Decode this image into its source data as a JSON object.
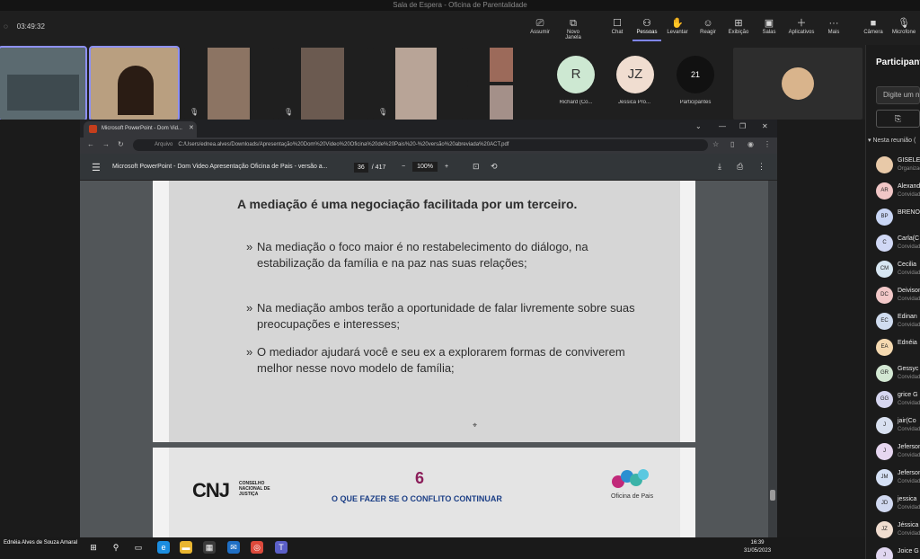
{
  "window_title": "Sala de Espera - Oficina de Parentalidade",
  "meeting": {
    "timer": "03:49:32"
  },
  "toolbar": [
    {
      "label": "Assumir",
      "icon": "screen-share-icon"
    },
    {
      "label": "Novo Janela",
      "icon": "new-window-icon"
    },
    {
      "label": "Chat",
      "icon": "chat-icon"
    },
    {
      "label": "Pessoas",
      "icon": "people-icon",
      "active": true
    },
    {
      "label": "Levantar",
      "icon": "raise-hand-icon"
    },
    {
      "label": "Reagir",
      "icon": "react-icon"
    },
    {
      "label": "Exibição",
      "icon": "view-icon"
    },
    {
      "label": "Salas",
      "icon": "rooms-icon"
    },
    {
      "label": "Aplicativos",
      "icon": "apps-icon"
    },
    {
      "label": "Mais",
      "icon": "more-icon"
    },
    {
      "label": "Câmera",
      "icon": "camera-icon"
    },
    {
      "label": "Microfone",
      "icon": "microphone-icon"
    }
  ],
  "avatars": [
    {
      "initial": "R",
      "name": "Richard (Co...",
      "color": "#cde8d2"
    },
    {
      "initial": "JZ",
      "name": "Jessica Pro...",
      "color": "#f0ddd0"
    },
    {
      "initial": "21",
      "name": "Participantes",
      "color": "#111111"
    }
  ],
  "right_panel": {
    "title": "Participantes",
    "search_placeholder": "Digite um nome",
    "share_label": "⎘",
    "section": "Nesta reunião (",
    "people": [
      {
        "initials": "",
        "name": "GISELE",
        "role": "Organizador",
        "color": "#e8c9a8"
      },
      {
        "initials": "AR",
        "name": "Alexandra",
        "role": "Convidado",
        "color": "#f1c6c6"
      },
      {
        "initials": "BP",
        "name": "BRENO",
        "role": "",
        "color": "#c9d6f5"
      },
      {
        "initials": "C",
        "name": "Carla(C",
        "role": "Convidado",
        "color": "#d0d8f5"
      },
      {
        "initials": "CM",
        "name": "Cecilia",
        "role": "Convidado",
        "color": "#d7e6f2"
      },
      {
        "initials": "DC",
        "name": "Deivison",
        "role": "Convidado",
        "color": "#f2c8c8"
      },
      {
        "initials": "EC",
        "name": "Edinan",
        "role": "Convidado",
        "color": "#d0dcf0"
      },
      {
        "initials": "EA",
        "name": "Ednéia",
        "role": "",
        "color": "#f5d9b0"
      },
      {
        "initials": "GR",
        "name": "Gessyc",
        "role": "Convidado",
        "color": "#d3e8d3"
      },
      {
        "initials": "GG",
        "name": "grice G",
        "role": "Convidado",
        "color": "#d6d6f0"
      },
      {
        "initials": "J",
        "name": "jair(Co",
        "role": "Convidado",
        "color": "#d8e0f0"
      },
      {
        "initials": "J",
        "name": "Jeferson",
        "role": "Convidado",
        "color": "#e6d6f0"
      },
      {
        "initials": "JM",
        "name": "Jeferson",
        "role": "Convidado",
        "color": "#d5e0f5"
      },
      {
        "initials": "JD",
        "name": "jessica",
        "role": "Convidado",
        "color": "#d0d8f0"
      },
      {
        "initials": "JZ",
        "name": "Jéssica",
        "role": "Convidado",
        "color": "#f0ddd0"
      },
      {
        "initials": "J",
        "name": "Joice G",
        "role": "",
        "color": "#e0d6f0"
      }
    ]
  },
  "browser": {
    "tab_title": "Microsoft PowerPoint - Dom Vid...",
    "address_prefix": "Arquivo",
    "url": "C:/Users/ednea.alves/Downloads/Apresentação%20Dom%20Video%20Oficina%20de%20Pais%20-%20versão%20abreviada%20ACT.pdf",
    "pdf_title": "Microsoft PowerPoint - Dom Video Apresentação Oficina de Pais - versão a...",
    "page_current": "36",
    "page_total": "/ 417",
    "zoom": "100%"
  },
  "slide1": {
    "heading": "A mediação é uma negociação facilitada por um terceiro.",
    "bullets": [
      "Na mediação o foco maior é no restabelecimento do diálogo, na estabilização da família e na paz nas suas relações;",
      "Na mediação ambos terão a oportunidade de falar livremente sobre suas preocupações e interesses;",
      "O mediador ajudará você e seu ex a explorarem formas de conviverem melhor nesse novo modelo de família;"
    ]
  },
  "slide2": {
    "cnj": "CNJ",
    "cnj_text": "CONSELHO NACIONAL DE JUSTIÇA",
    "number": "6",
    "subtitle": "O QUE FAZER SE O CONFLITO CONTINUAR",
    "brand": "Oficina de Pais"
  },
  "taskbar": {
    "presenter": "Ednéia Alves de Souza Amaral",
    "time": "16:39",
    "date": "31/05/2023"
  },
  "colors": {
    "accent": "#7f85f5",
    "slide_number": "#8b1e5a",
    "slide_subtitle": "#1c3f86"
  }
}
